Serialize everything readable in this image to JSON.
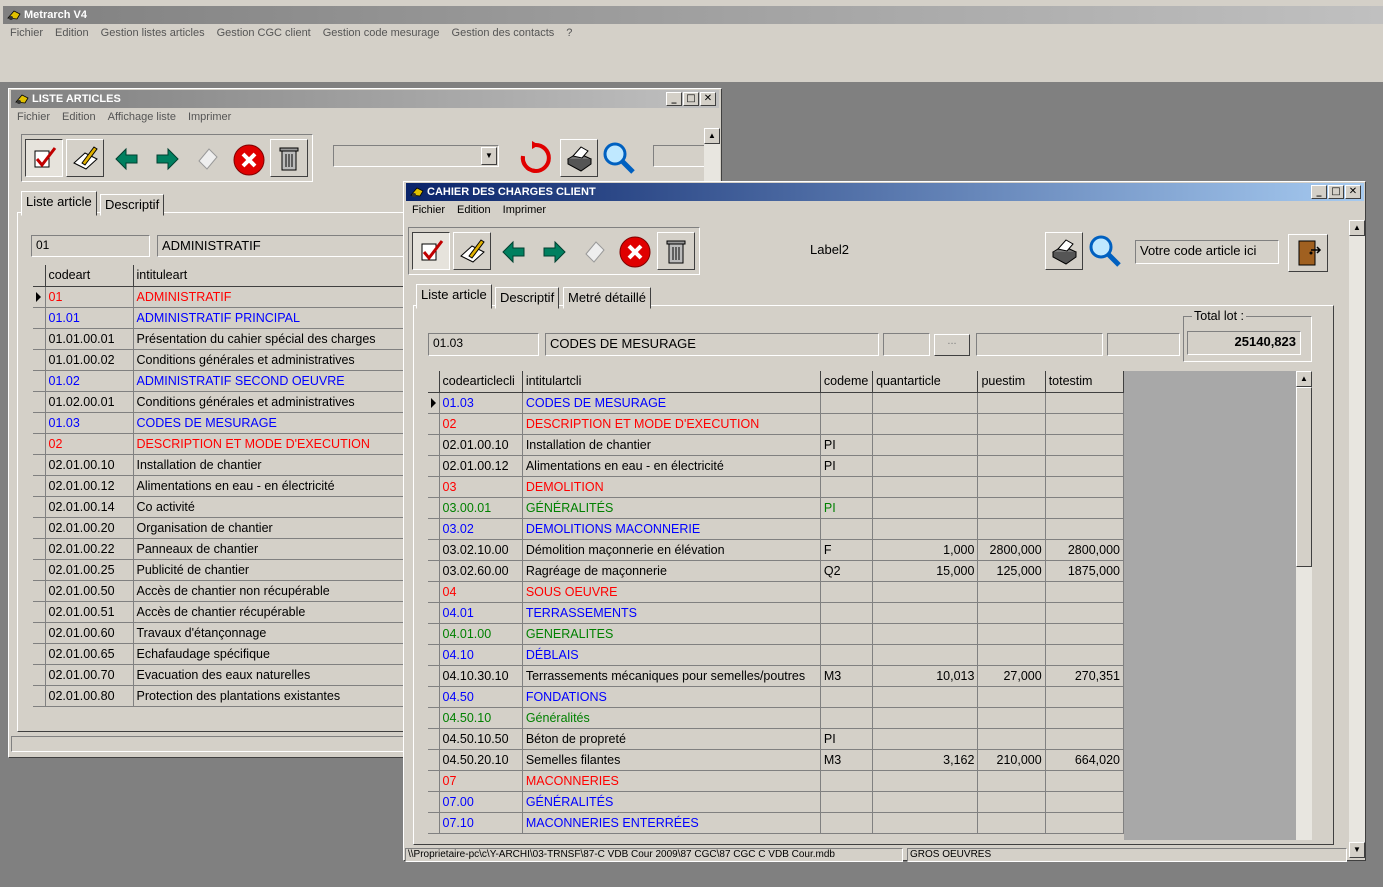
{
  "app": {
    "title": "Metrarch V4",
    "menu": [
      "Fichier",
      "Edition",
      "Gestion listes articles",
      "Gestion CGC client",
      "Gestion code mesurage",
      "Gestion des contacts",
      "?"
    ]
  },
  "liste": {
    "title": "LISTE ARTICLES",
    "menu": [
      "Fichier",
      "Edition",
      "Affichage liste",
      "Imprimer"
    ],
    "tabs": [
      "Liste article",
      "Descriptif"
    ],
    "code_value": "01",
    "label_value": "ADMINISTRATIF",
    "columns": [
      "codeart",
      "intituleart"
    ],
    "rows": [
      {
        "code": "01",
        "label": "ADMINISTRATIF",
        "color": "red",
        "current": true
      },
      {
        "code": "01.01",
        "label": "ADMINISTRATIF PRINCIPAL",
        "color": "blue"
      },
      {
        "code": "01.01.00.01",
        "label": "Présentation du cahier spécial des charges",
        "color": "black"
      },
      {
        "code": "01.01.00.02",
        "label": "Conditions générales et administratives",
        "color": "black"
      },
      {
        "code": "01.02",
        "label": "ADMINISTRATIF SECOND OEUVRE",
        "color": "blue"
      },
      {
        "code": "01.02.00.01",
        "label": "Conditions générales et administratives",
        "color": "black"
      },
      {
        "code": "01.03",
        "label": "CODES DE MESURAGE",
        "color": "blue"
      },
      {
        "code": "02",
        "label": "DESCRIPTION ET MODE D'EXECUTION",
        "color": "red"
      },
      {
        "code": "02.01.00.10",
        "label": "Installation de chantier",
        "color": "black"
      },
      {
        "code": "02.01.00.12",
        "label": "Alimentations en eau - en électricité",
        "color": "black"
      },
      {
        "code": "02.01.00.14",
        "label": "Co activité",
        "color": "black"
      },
      {
        "code": "02.01.00.20",
        "label": "Organisation de chantier",
        "color": "black"
      },
      {
        "code": "02.01.00.22",
        "label": "Panneaux de chantier",
        "color": "black"
      },
      {
        "code": "02.01.00.25",
        "label": "Publicité de chantier",
        "color": "black"
      },
      {
        "code": "02.01.00.50",
        "label": "Accès de chantier non récupérable",
        "color": "black"
      },
      {
        "code": "02.01.00.51",
        "label": "Accès de chantier récupérable",
        "color": "black"
      },
      {
        "code": "02.01.00.60",
        "label": "Travaux d'étançonnage",
        "color": "black"
      },
      {
        "code": "02.01.00.65",
        "label": "Echafaudage spécifique",
        "color": "black"
      },
      {
        "code": "02.01.00.70",
        "label": "Evacuation des eaux naturelles",
        "color": "black"
      },
      {
        "code": "02.01.00.80",
        "label": "Protection des plantations existantes",
        "color": "black"
      }
    ]
  },
  "cahier": {
    "title": "CAHIER DES CHARGES CLIENT",
    "menu": [
      "Fichier",
      "Edition",
      "Imprimer"
    ],
    "label2": "Label2",
    "search_value": "Votre code article ici",
    "tabs": [
      "Liste article",
      "Descriptif",
      "Metré détaillé"
    ],
    "code_value": "01.03",
    "label_value": "CODES DE MESURAGE",
    "ellipsis": "...",
    "total_label": "Total lot :",
    "total_value": "25140,823",
    "columns": [
      "codearticlecli",
      "intitulartcli",
      "codeme",
      "quantarticle",
      "puestim",
      "totestim"
    ],
    "rows": [
      {
        "code": "01.03",
        "label": "CODES DE MESURAGE",
        "unit": "",
        "qty": "",
        "pu": "",
        "tot": "",
        "color": "blue",
        "current": true
      },
      {
        "code": "02",
        "label": "DESCRIPTION ET MODE D'EXECUTION",
        "unit": "",
        "qty": "",
        "pu": "",
        "tot": "",
        "color": "red"
      },
      {
        "code": "02.01.00.10",
        "label": "Installation de chantier",
        "unit": "PI",
        "qty": "",
        "pu": "",
        "tot": "",
        "color": "black"
      },
      {
        "code": "02.01.00.12",
        "label": "Alimentations en eau - en électricité",
        "unit": "PI",
        "qty": "",
        "pu": "",
        "tot": "",
        "color": "black"
      },
      {
        "code": "03",
        "label": "DEMOLITION",
        "unit": "",
        "qty": "",
        "pu": "",
        "tot": "",
        "color": "red"
      },
      {
        "code": "03.00.01",
        "label": "GÉNÉRALITÉS",
        "unit": "PI",
        "qty": "",
        "pu": "",
        "tot": "",
        "color": "green"
      },
      {
        "code": "03.02",
        "label": "DEMOLITIONS MACONNERIE",
        "unit": "",
        "qty": "",
        "pu": "",
        "tot": "",
        "color": "blue"
      },
      {
        "code": "03.02.10.00",
        "label": "Démolition maçonnerie en élévation",
        "unit": "F",
        "qty": "1,000",
        "pu": "2800,000",
        "tot": "2800,000",
        "color": "black"
      },
      {
        "code": "03.02.60.00",
        "label": "Ragréage de maçonnerie",
        "unit": "Q2",
        "qty": "15,000",
        "pu": "125,000",
        "tot": "1875,000",
        "color": "black"
      },
      {
        "code": "04",
        "label": "SOUS OEUVRE",
        "unit": "",
        "qty": "",
        "pu": "",
        "tot": "",
        "color": "red"
      },
      {
        "code": "04.01",
        "label": "TERRASSEMENTS",
        "unit": "",
        "qty": "",
        "pu": "",
        "tot": "",
        "color": "blue"
      },
      {
        "code": "04.01.00",
        "label": "GENERALITES",
        "unit": "",
        "qty": "",
        "pu": "",
        "tot": "",
        "color": "green"
      },
      {
        "code": "04.10",
        "label": "DÉBLAIS",
        "unit": "",
        "qty": "",
        "pu": "",
        "tot": "",
        "color": "blue"
      },
      {
        "code": "04.10.30.10",
        "label": "Terrassements mécaniques pour semelles/poutres",
        "unit": "M3",
        "qty": "10,013",
        "pu": "27,000",
        "tot": "270,351",
        "color": "black"
      },
      {
        "code": "04.50",
        "label": "FONDATIONS",
        "unit": "",
        "qty": "",
        "pu": "",
        "tot": "",
        "color": "blue"
      },
      {
        "code": "04.50.10",
        "label": "Généralités",
        "unit": "",
        "qty": "",
        "pu": "",
        "tot": "",
        "color": "green"
      },
      {
        "code": "04.50.10.50",
        "label": "Béton de propreté",
        "unit": "PI",
        "qty": "",
        "pu": "",
        "tot": "",
        "color": "black"
      },
      {
        "code": "04.50.20.10",
        "label": "Semelles filantes",
        "unit": "M3",
        "qty": "3,162",
        "pu": "210,000",
        "tot": "664,020",
        "color": "black"
      },
      {
        "code": "07",
        "label": "MACONNERIES",
        "unit": "",
        "qty": "",
        "pu": "",
        "tot": "",
        "color": "red"
      },
      {
        "code": "07.00",
        "label": "GÉNÉRALITÉS",
        "unit": "",
        "qty": "",
        "pu": "",
        "tot": "",
        "color": "blue"
      },
      {
        "code": "07.10",
        "label": "MACONNERIES ENTERRÉES",
        "unit": "",
        "qty": "",
        "pu": "",
        "tot": "",
        "color": "blue"
      }
    ],
    "status_path": "\\\\Proprietaire-pc\\c\\Y-ARCHI\\03-TRNSF\\87-C VDB Cour 2009\\87 CGC\\87 CGC C VDB Cour.mdb",
    "status_lot": "GROS OEUVRES"
  },
  "colors": {
    "red": "#ff0000",
    "blue": "#0000ff",
    "green": "#008000",
    "black": "#000000"
  }
}
